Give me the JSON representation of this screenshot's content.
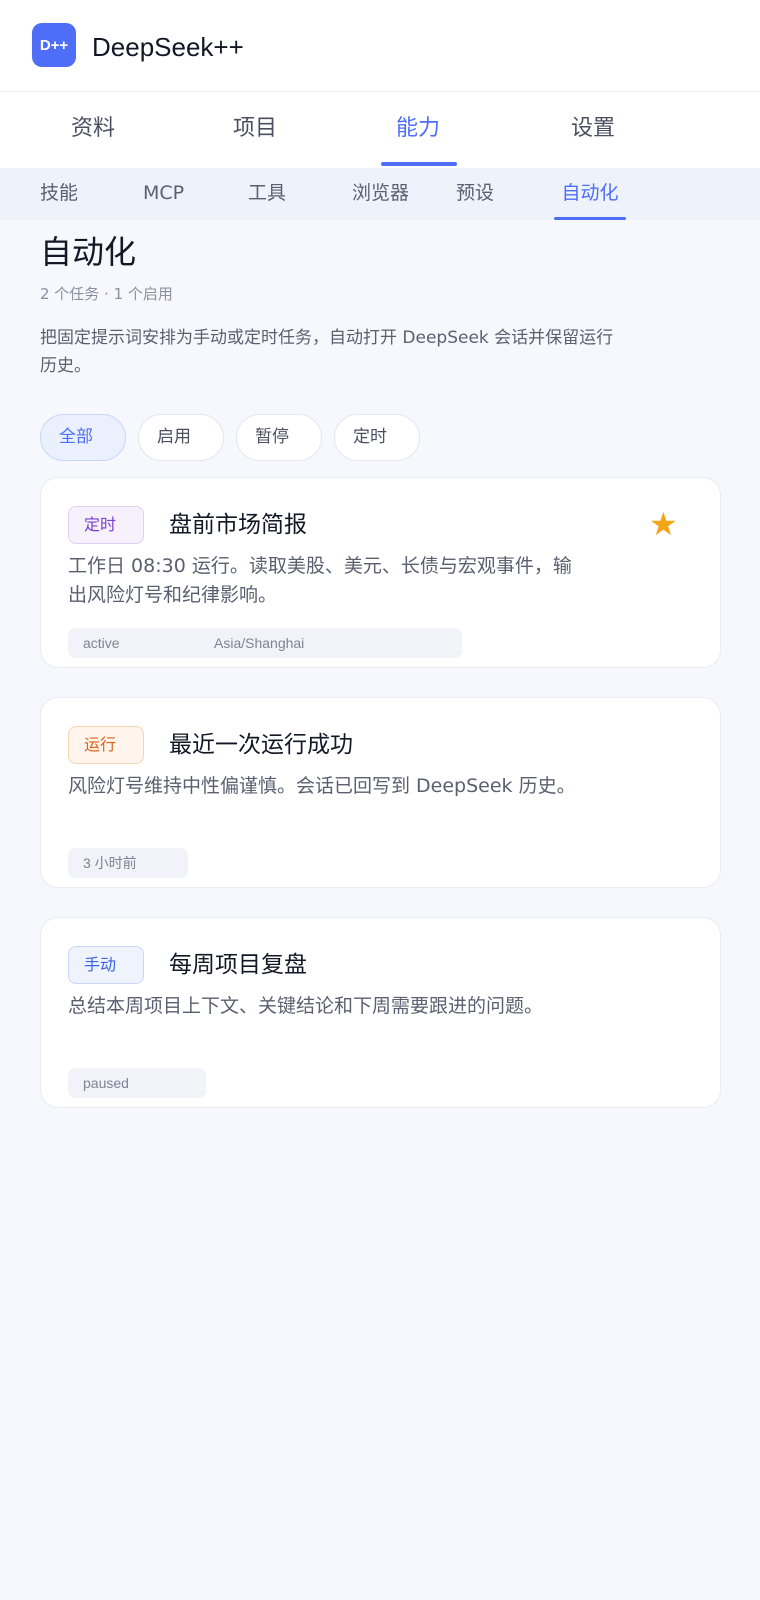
{
  "app": {
    "logo_text": "D++",
    "title": "DeepSeek++"
  },
  "main_tabs": [
    {
      "label": "资料",
      "active": false
    },
    {
      "label": "项目",
      "active": false
    },
    {
      "label": "能力",
      "active": true
    },
    {
      "label": "设置",
      "active": false
    }
  ],
  "sub_tabs": [
    {
      "label": "技能",
      "active": false
    },
    {
      "label": "MCP",
      "active": false
    },
    {
      "label": "工具",
      "active": false
    },
    {
      "label": "浏览器",
      "active": false
    },
    {
      "label": "预设",
      "active": false
    },
    {
      "label": "自动化",
      "active": true
    }
  ],
  "page": {
    "title": "自动化",
    "meta": "2 个任务 · 1 个启用",
    "description": "把固定提示词安排为手动或定时任务，自动打开 DeepSeek 会话并保留运行历史。"
  },
  "filters": [
    {
      "label": "全部",
      "active": true
    },
    {
      "label": "启用",
      "active": false
    },
    {
      "label": "暂停",
      "active": false
    },
    {
      "label": "定时",
      "active": false
    }
  ],
  "cards": [
    {
      "badge": "定时",
      "title": "盘前市场简报",
      "description": "工作日 08:30 运行。读取美股、美元、长债与宏观事件，输出风险灯号和纪律影响。",
      "tags": [
        "active",
        "Asia/Shanghai"
      ],
      "starred": true,
      "star_icon": "star-icon"
    },
    {
      "badge": "运行",
      "title": "最近一次运行成功",
      "description": "风险灯号维持中性偏谨慎。会话已回写到 DeepSeek 历史。",
      "tags": [
        "3 小时前"
      ]
    },
    {
      "badge": "手动",
      "title": "每周项目复盘",
      "description": "总结本周项目上下文、关键结论和下周需要跟进的问题。",
      "tags": [
        "paused"
      ]
    }
  ],
  "colors": {
    "accent": "#4f6ef7",
    "star": "#f2a516",
    "badge_scheduled": "#7a3fcf",
    "badge_run": "#d9641a",
    "badge_manual": "#3c64e0"
  }
}
